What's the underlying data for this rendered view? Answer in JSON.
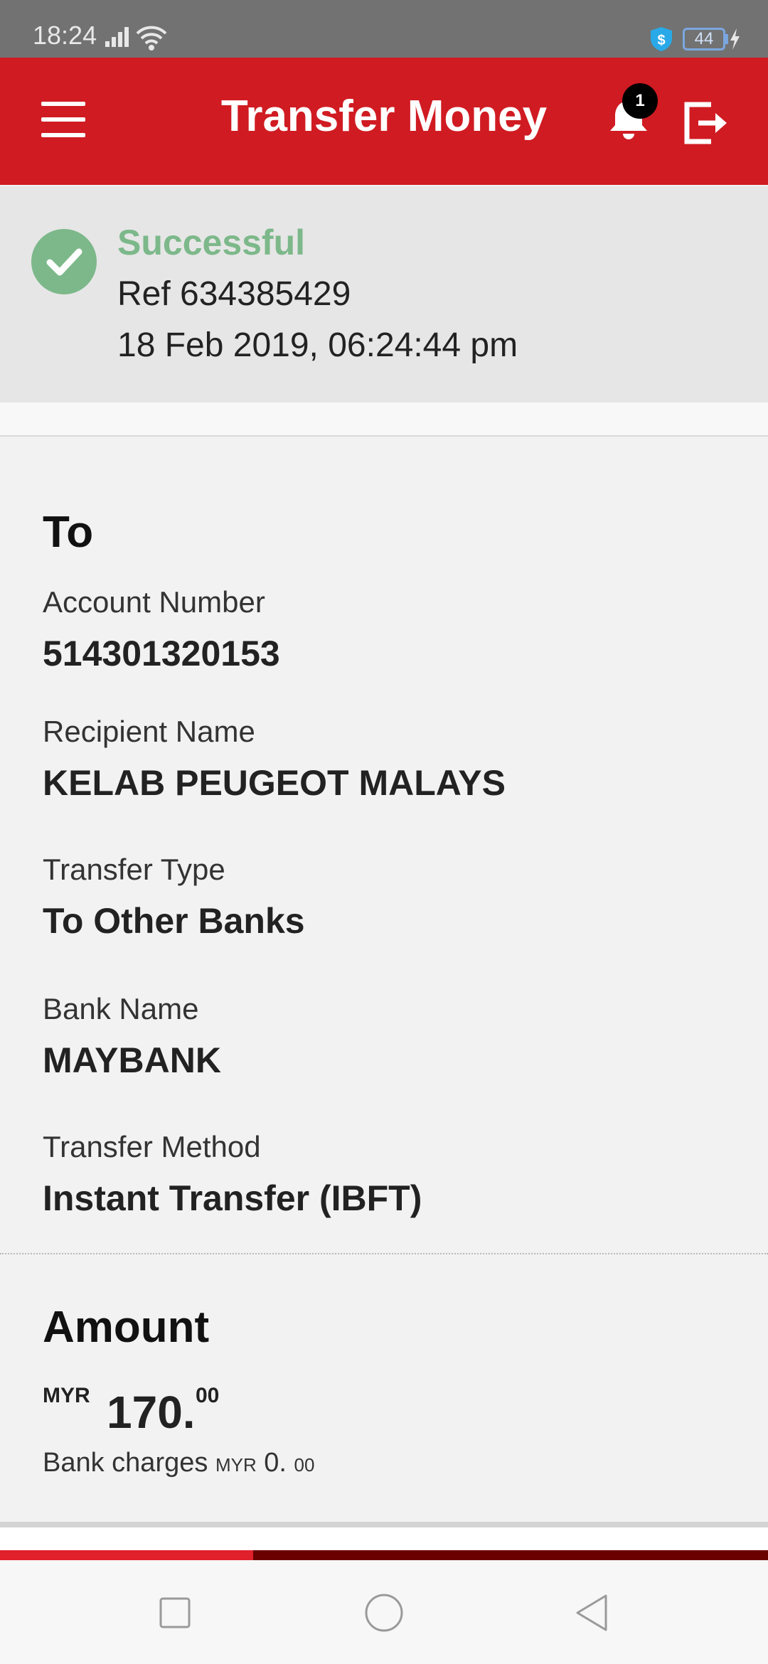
{
  "status_bar": {
    "time": "18:24",
    "battery_level": "44",
    "icons": [
      "signal-icon",
      "wifi-icon",
      "shield-dollar-icon",
      "battery-icon",
      "charging-icon"
    ]
  },
  "header": {
    "title": "Transfer Money",
    "notification_count": "1",
    "background_color": "#d01b22",
    "icons": [
      "menu-icon",
      "bell-icon",
      "logout-icon"
    ]
  },
  "result": {
    "status": "Successful",
    "reference": "Ref 634385429",
    "timestamp": "18 Feb 2019, 06:24:44 pm",
    "status_color": "#7cb88a"
  },
  "recipient": {
    "heading": "To",
    "fields": [
      {
        "label": "Account Number",
        "value": "514301320153"
      },
      {
        "label": "Recipient Name",
        "value": "KELAB PEUGEOT MALAYS"
      },
      {
        "label": "Transfer Type",
        "value": "To Other Banks"
      },
      {
        "label": "Bank Name",
        "value": "MAYBANK"
      },
      {
        "label": "Transfer Method",
        "value": "Instant Transfer (IBFT)"
      }
    ]
  },
  "amount": {
    "heading": "Amount",
    "currency": "MYR",
    "major": "170.",
    "minor": "00",
    "charges_label": "Bank charges",
    "charges_currency": "MYR",
    "charges_major": "0.",
    "charges_minor": "00"
  },
  "loading_progress": 0.33,
  "nav_bar": {
    "icons": [
      "recents-square-icon",
      "home-circle-icon",
      "back-triangle-icon"
    ]
  }
}
